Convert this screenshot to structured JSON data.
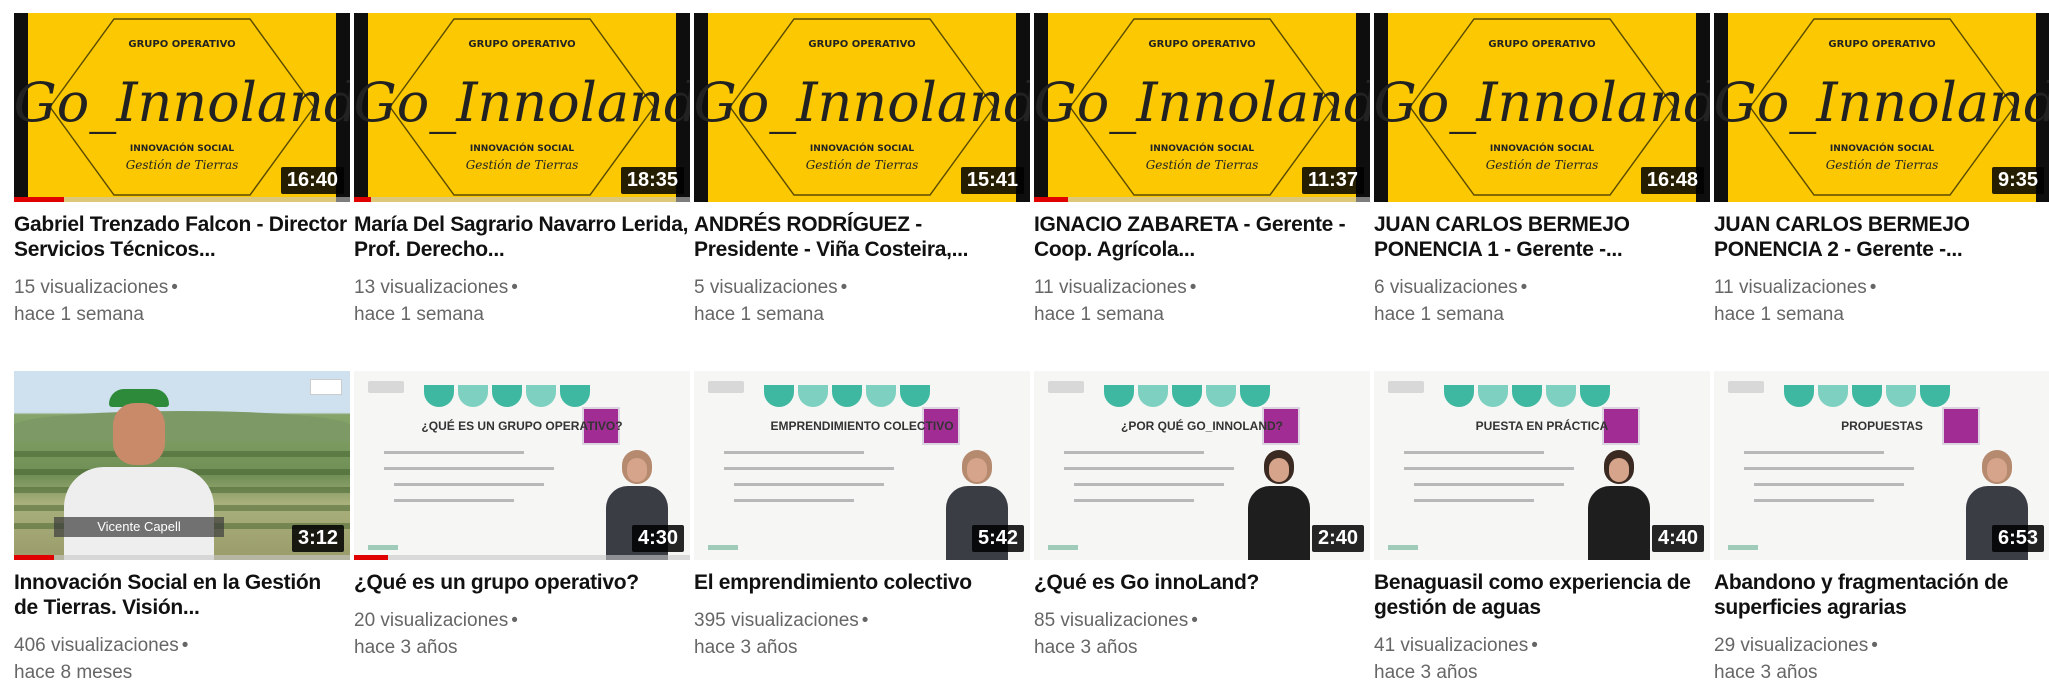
{
  "videos": [
    {
      "title": "Gabriel Trenzado Falcon - Director Servicios Técnicos...",
      "views": "15 visualizaciones",
      "age": "hace 1 semana",
      "duration": "16:40",
      "watched_fraction": 0.15,
      "thumbnail": "go-innoland"
    },
    {
      "title": "María Del Sagrario Navarro Lerida, Prof. Derecho...",
      "views": "13 visualizaciones",
      "age": "hace 1 semana",
      "duration": "18:35",
      "watched_fraction": 0.05,
      "thumbnail": "go-innoland"
    },
    {
      "title": "ANDRÉS RODRÍGUEZ - Presidente - Viña Costeira,...",
      "views": "5 visualizaciones",
      "age": "hace 1 semana",
      "duration": "15:41",
      "watched_fraction": 0,
      "thumbnail": "go-innoland"
    },
    {
      "title": "IGNACIO ZABARETA - Gerente - Coop. Agrícola...",
      "views": "11 visualizaciones",
      "age": "hace 1 semana",
      "duration": "11:37",
      "watched_fraction": 0.1,
      "thumbnail": "go-innoland"
    },
    {
      "title": "JUAN CARLOS BERMEJO PONENCIA 1 - Gerente -...",
      "views": "6 visualizaciones",
      "age": "hace 1 semana",
      "duration": "16:48",
      "watched_fraction": 0,
      "thumbnail": "go-innoland"
    },
    {
      "title": "JUAN CARLOS BERMEJO PONENCIA 2 - Gerente -...",
      "views": "11 visualizaciones",
      "age": "hace 1 semana",
      "duration": "9:35",
      "watched_fraction": 0,
      "thumbnail": "go-innoland"
    },
    {
      "title": "Innovación Social en la Gestión de Tierras. Visión...",
      "views": "406 visualizaciones",
      "age": "hace 8 meses",
      "duration": "3:12",
      "watched_fraction": 0.12,
      "thumbnail": "photo",
      "caption": "Vicente Capell"
    },
    {
      "title": "¿Qué es un grupo operativo?",
      "views": "20 visualizaciones",
      "age": "hace 3 años",
      "duration": "4:30",
      "watched_fraction": 0.1,
      "thumbnail": "slide",
      "slide_heading": "¿QUÉ ES UN GRUPO OPERATIVO?"
    },
    {
      "title": "El emprendimiento colectivo",
      "views": "395 visualizaciones",
      "age": "hace 3 años",
      "duration": "5:42",
      "watched_fraction": 0,
      "thumbnail": "slide",
      "slide_heading": "EMPRENDIMIENTO COLECTIVO"
    },
    {
      "title": "¿Qué es Go innoLand?",
      "views": "85 visualizaciones",
      "age": "hace 3 años",
      "duration": "2:40",
      "watched_fraction": 0,
      "thumbnail": "slide",
      "slide_heading": "¿POR QUÉ GO_INNOLAND?"
    },
    {
      "title": "Benaguasil como experiencia de gestión de aguas",
      "views": "41 visualizaciones",
      "age": "hace 3 años",
      "duration": "4:40",
      "watched_fraction": 0,
      "thumbnail": "slide",
      "slide_heading": "PUESTA EN PRÁCTICA"
    },
    {
      "title": "Abandono y fragmentación de superficies agrarias",
      "views": "29 visualizaciones",
      "age": "hace 3 años",
      "duration": "6:53",
      "watched_fraction": 0,
      "thumbnail": "slide",
      "slide_heading": "PROPUESTAS"
    }
  ],
  "thumbnail_text": {
    "group": "GRUPO OPERATIVO",
    "brand": "Go_Innoland",
    "sub": "INNOVACIÓN SOCIAL",
    "tag": "Gestión de Tierras"
  },
  "separator": "•",
  "colors": {
    "thumb_yellow": "#fbc801",
    "progress_red": "#e00000",
    "badge_purple": "#a12d94",
    "accent_teal": "#3fb8a2"
  }
}
